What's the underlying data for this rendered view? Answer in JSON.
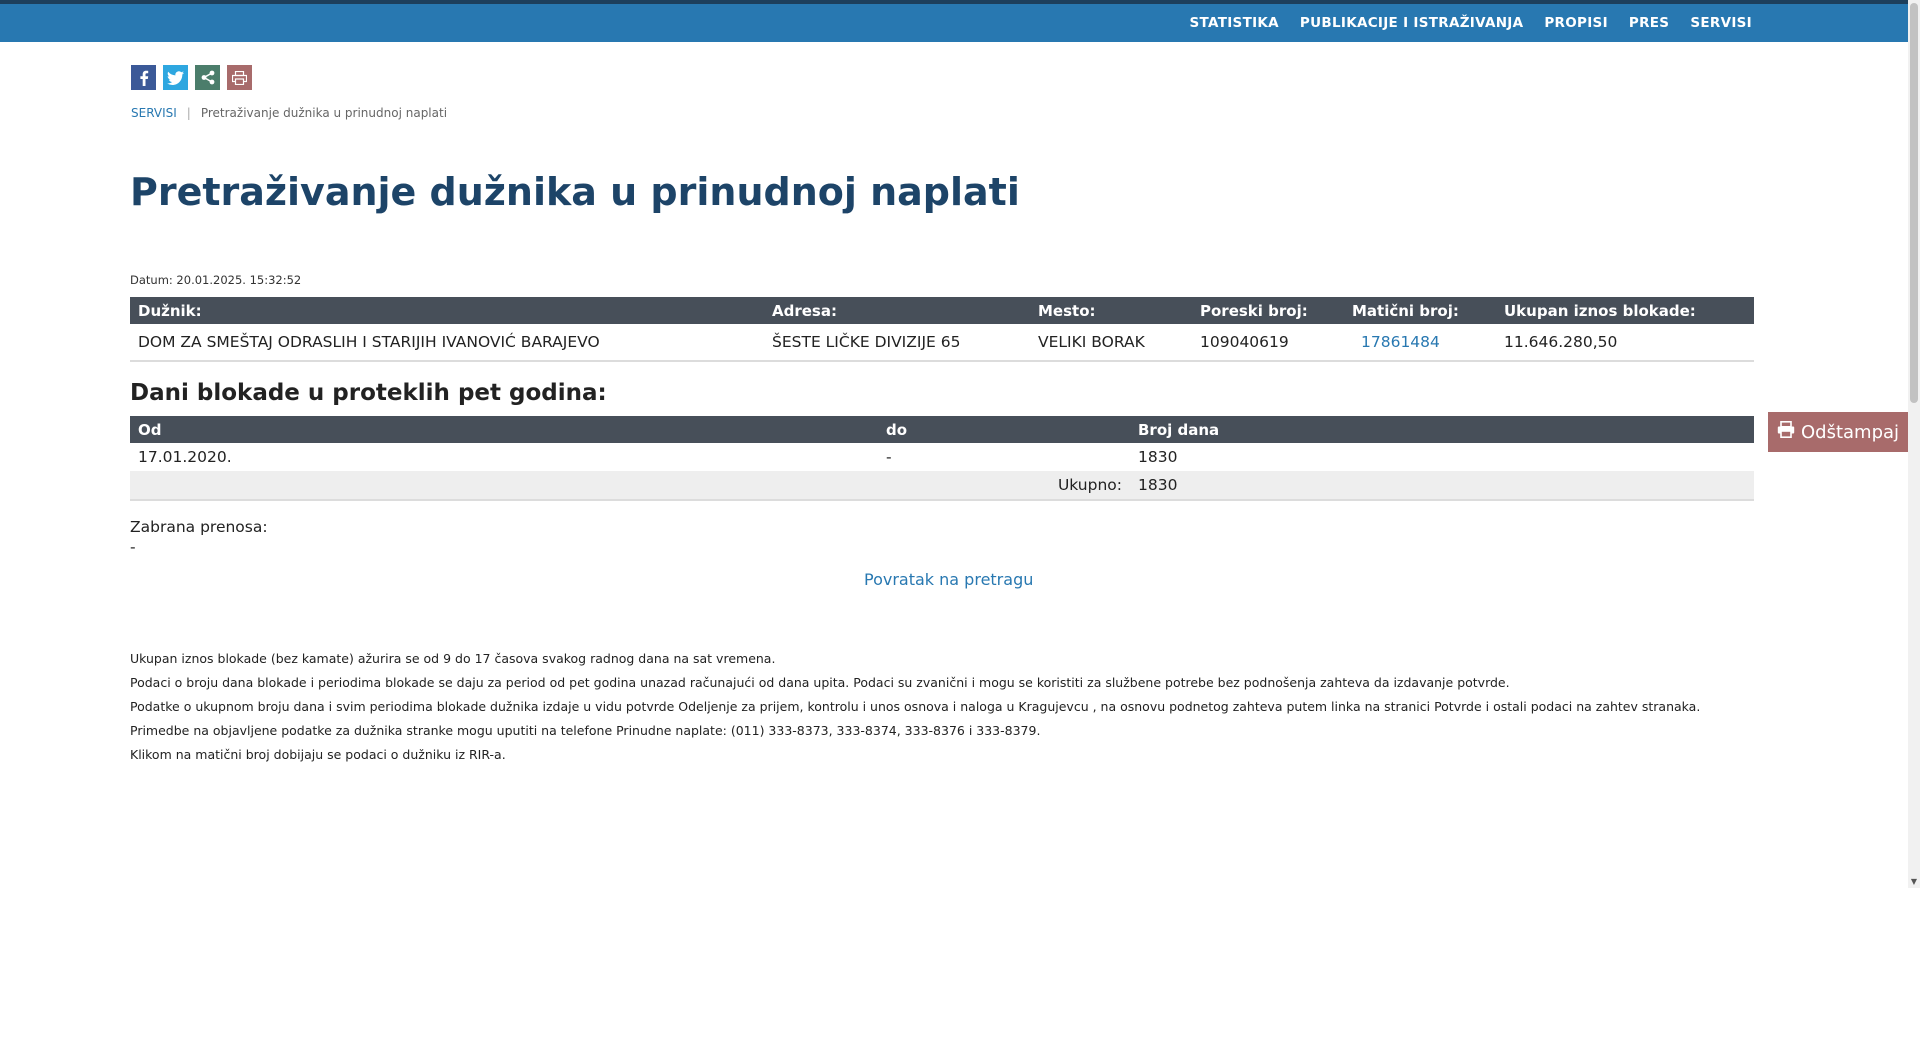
{
  "nav": {
    "items": [
      "STATISTIKA",
      "PUBLIKACIJE I ISTRAŽIVANJA",
      "PROPISI",
      "PRES",
      "SERVISI"
    ]
  },
  "share": {
    "icons": [
      "facebook-icon",
      "twitter-icon",
      "share-icon",
      "print-icon"
    ],
    "colors": {
      "facebook": "#3b5998",
      "twitter": "#2ea7e0",
      "share": "#4b7d6b",
      "print": "#a86b6b"
    }
  },
  "breadcrumb": {
    "home": "SERVISI",
    "current": "Pretraživanje dužnika u prinudnoj naplati"
  },
  "page": {
    "title": "Pretraživanje dužnika u prinudnoj naplati",
    "datum": "Datum: 20.01.2025. 15:32:52"
  },
  "debtor": {
    "headers": [
      "Dužnik:",
      "Adresa:",
      "Mesto:",
      "Poreski broj:",
      "Matični broj:",
      "Ukupan iznos blokade:"
    ],
    "row": {
      "name": "DOM ZA SMEŠTAJ ODRASLIH I STARIJIH IVANOVIĆ BARAJEVO",
      "address": "ŠESTE LIČKE DIVIZIJE 65",
      "place": "VELIKI BORAK",
      "tax_number": "109040619",
      "reg_number": "17861484",
      "total_amount": "11.646.280,50"
    }
  },
  "blockade": {
    "heading": "Dani blokade u proteklih pet godina:",
    "headers": [
      "Od",
      "do",
      "Broj dana"
    ],
    "row": {
      "from": "17.01.2020.",
      "to": "-",
      "days": "1830"
    },
    "total_label": "Ukupno:",
    "total_value": "1830"
  },
  "print_button": {
    "label": "Odštampaj",
    "icon": "printer-icon"
  },
  "zabrana": {
    "label": "Zabrana prenosa:",
    "value": "-"
  },
  "back_link": "Povratak na pretragu",
  "notes": [
    "Ukupan iznos blokade (bez kamate) ažurira se od 9 do 17 časova svakog radnog dana na sat vremena.",
    "Podaci o broju dana blokade i periodima blokade se daju za period od pet godina unazad računajući od dana upita. Podaci su zvanični i mogu se koristiti za službene potrebe bez podnošenja zahteva da izdavanje potvrde.",
    "Podatke o ukupnom broju dana i svim periodima blokade dužnika izdaje u vidu potvrde Odeljenje za prijem, kontrolu i unos osnova i naloga u Kragujevcu , na osnovu podnetog zahteva putem linka na stranici Potvrde i ostali podaci na zahtev stranaka.",
    "Primedbe na objavljene podatke za dužnika stranke mogu uputiti na telefone Prinudne naplate: (011) 333-8373, 333-8374, 333-8376 i 333-8379.",
    "Klikom na matični broj dobijaju se podaci o dužniku iz RIR-a."
  ]
}
